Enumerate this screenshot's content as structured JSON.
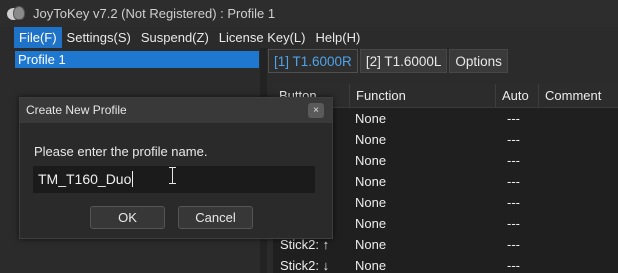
{
  "window": {
    "title": "JoyToKey v7.2 (Not Registered) : Profile 1"
  },
  "menu": [
    {
      "label": "File(F)"
    },
    {
      "label": "Settings(S)"
    },
    {
      "label": "Suspend(Z)"
    },
    {
      "label": "License Key(L)"
    },
    {
      "label": "Help(H)"
    }
  ],
  "profiles": [
    {
      "label": "Profile 1"
    }
  ],
  "tabs": [
    {
      "label": "[1] T1.6000R"
    },
    {
      "label": "[2] T1.6000L"
    },
    {
      "label": "Options"
    }
  ],
  "table": {
    "columns": [
      "Button",
      "Function",
      "Auto",
      "Comment"
    ],
    "rows": [
      {
        "button": "",
        "function": "None",
        "auto": "---"
      },
      {
        "button": "",
        "function": "None",
        "auto": "---"
      },
      {
        "button": "",
        "function": "None",
        "auto": "---"
      },
      {
        "button": "",
        "function": "None",
        "auto": "---"
      },
      {
        "button": "",
        "function": "None",
        "auto": "---"
      },
      {
        "button": "",
        "function": "None",
        "auto": "---"
      },
      {
        "button": "Stick2: ↑",
        "function": "None",
        "auto": "---"
      },
      {
        "button": "Stick2: ↓",
        "function": "None",
        "auto": "---"
      }
    ]
  },
  "dialog": {
    "title": "Create New Profile",
    "prompt": "Please enter the profile name.",
    "input_value": "TM_T160_Duo",
    "ok_label": "OK",
    "cancel_label": "Cancel",
    "close_glyph": "×"
  },
  "colors": {
    "accent": "#1f78d0",
    "active_tab_text": "#4fa3ea",
    "background": "#2b2b2b"
  }
}
